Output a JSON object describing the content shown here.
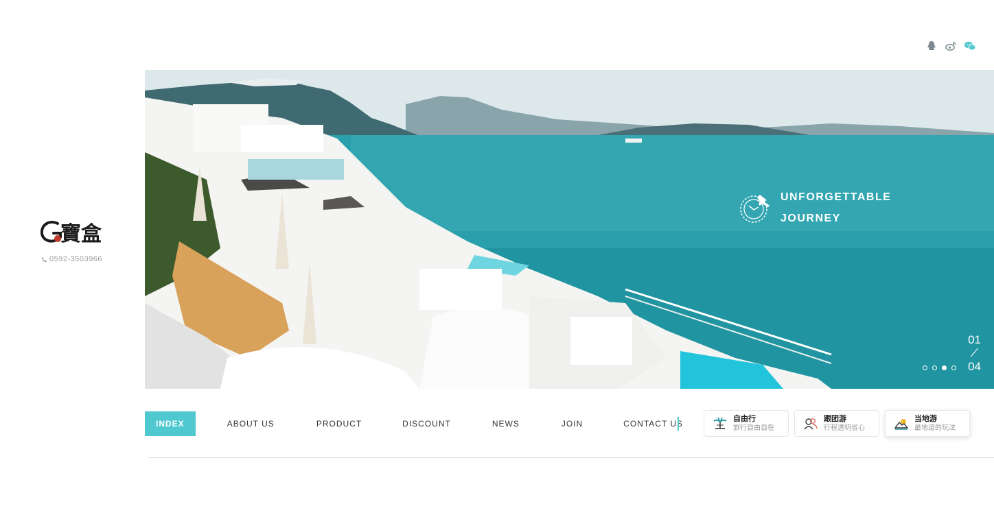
{
  "social": {
    "icons": [
      "qq-icon",
      "weibo-icon",
      "wechat-icon"
    ],
    "accent": "#4fc8cf"
  },
  "logo": {
    "alt_text": "G寶盒"
  },
  "contact": {
    "phone": "0592-3503966"
  },
  "hero": {
    "tagline_line1": "UNFORGETTABLE",
    "tagline_line2": "JOURNEY",
    "slide_current": "01",
    "slide_total": "04",
    "active_dot": 3,
    "dot_count": 4
  },
  "nav": {
    "items": [
      "INDEX",
      "ABOUT US",
      "PRODUCT",
      "DISCOUNT",
      "NEWS",
      "JOIN",
      "CONTACT US"
    ],
    "active_index": 0,
    "active_color": "#4fc8cf"
  },
  "cards": [
    {
      "title": "自由行",
      "subtitle": "旅行自由自在",
      "icon": "palm-tree-icon"
    },
    {
      "title": "跟团游",
      "subtitle": "行程透明省心",
      "icon": "group-icon"
    },
    {
      "title": "当地游",
      "subtitle": "最地道的玩法",
      "icon": "landscape-icon"
    }
  ]
}
